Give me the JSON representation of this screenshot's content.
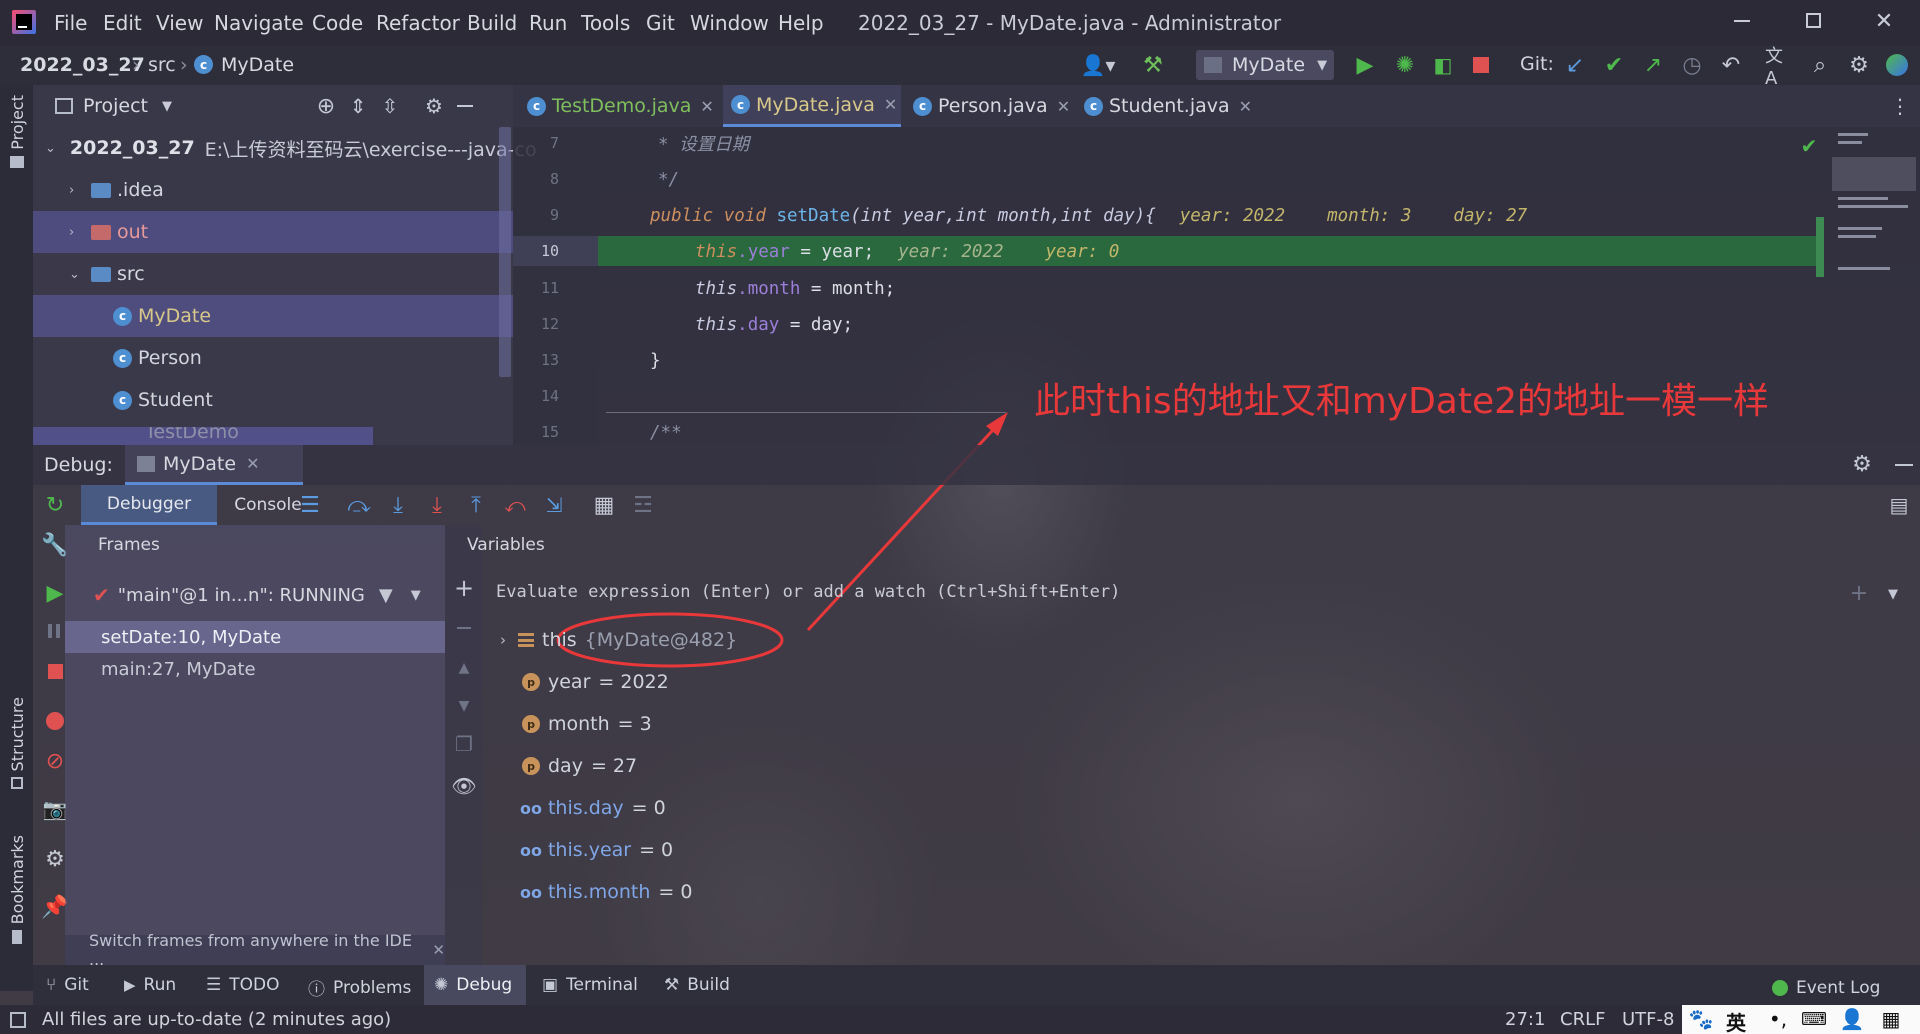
{
  "window": {
    "title": "2022_03_27 - MyDate.java - Administrator",
    "menu": [
      "File",
      "Edit",
      "View",
      "Navigate",
      "Code",
      "Refactor",
      "Build",
      "Run",
      "Tools",
      "Git",
      "Window",
      "Help"
    ]
  },
  "breadcrumb": {
    "project": "2022_03_27",
    "folder": "src",
    "file": "MyDate"
  },
  "toolbar": {
    "run_config": "MyDate",
    "git_label": "Git:"
  },
  "project_panel": {
    "title": "Project",
    "root_name": "2022_03_27",
    "root_path": "E:\\上传资料至码云\\exercise---java-co",
    "items": [
      {
        "label": ".idea"
      },
      {
        "label": "out"
      },
      {
        "label": "src"
      },
      {
        "label": "MyDate"
      },
      {
        "label": "Person"
      },
      {
        "label": "Student"
      },
      {
        "label": "TestDemo"
      }
    ]
  },
  "editor_tabs": [
    "TestDemo.java",
    "MyDate.java",
    "Person.java",
    "Student.java"
  ],
  "code": {
    "line_numbers": [
      "7",
      "8",
      "9",
      "10",
      "11",
      "12",
      "13",
      "14",
      "15"
    ],
    "l7": "* 设置日期",
    "l8": "*/",
    "l9_kw": "public void ",
    "l9_fn": "setDate",
    "l9_params": "(int year,int month,int day){",
    "l9_hints": [
      "year: 2022",
      "month: 3",
      "day: 27"
    ],
    "l10_this": "this",
    "l10_field": ".year",
    "l10_rest": " = year;",
    "l10_hints": [
      "year: 2022",
      "year: 0"
    ],
    "l11_this": "this",
    "l11_field": ".month",
    "l11_rest": " = month;",
    "l12_this": "this",
    "l12_field": ".day",
    "l12_rest": " = day;",
    "l13": "}",
    "l15": "/**"
  },
  "annotation": {
    "text": "此时this的地址又和myDate2的地址一模一样",
    "color": "#e8383a"
  },
  "debug": {
    "label": "Debug:",
    "session_tab": "MyDate",
    "tabs": [
      "Debugger",
      "Console"
    ],
    "frames_title": "Frames",
    "variables_title": "Variables",
    "thread": "\"main\"@1 in...n\": RUNNING",
    "frames": [
      "setDate:10, MyDate",
      "main:27, MyDate"
    ],
    "frames_hint": "Switch frames from anywhere in the IDE ...",
    "evaluate_placeholder": "Evaluate expression (Enter) or add a watch (Ctrl+Shift+Enter)",
    "variables": [
      {
        "name": "this",
        "value": "{MyDate@482}",
        "kind": "object"
      },
      {
        "name": "year",
        "value": "= 2022",
        "kind": "param"
      },
      {
        "name": "month",
        "value": "= 3",
        "kind": "param"
      },
      {
        "name": "day",
        "value": "= 27",
        "kind": "param"
      },
      {
        "name": "this.day",
        "value": "= 0",
        "kind": "watch"
      },
      {
        "name": "this.year",
        "value": "= 0",
        "kind": "watch"
      },
      {
        "name": "this.month",
        "value": "= 0",
        "kind": "watch"
      }
    ]
  },
  "bottom_tabs": [
    "Git",
    "Run",
    "TODO",
    "Problems",
    "Debug",
    "Terminal",
    "Build"
  ],
  "event_log": "Event Log",
  "side_labels": {
    "project": "Project",
    "structure": "Structure",
    "bookmarks": "Bookmarks"
  },
  "status": {
    "message": "All files are up-to-date (2 minutes ago)",
    "position": "27:1",
    "line_sep": "CRLF",
    "encoding": "UTF-8",
    "ime": "英"
  },
  "colors": {
    "accent": "#5b8bd6",
    "run_green": "#4fb84c",
    "stop_red": "#e05252",
    "highlight_line": "#2f6b3c"
  }
}
